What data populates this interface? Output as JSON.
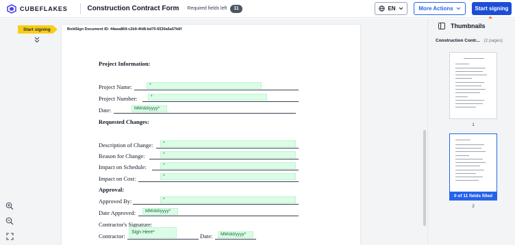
{
  "header": {
    "brand": "CUBEFLAKES",
    "doc_title": "Construction Contract Form",
    "required_label": "Required fields left",
    "required_count": "11",
    "language": "EN",
    "more_actions": "More Actions",
    "start_signing": "Start signing"
  },
  "sidebar": {
    "start_tag": "Start signing"
  },
  "document": {
    "doc_id": "BoldSign Document ID: 44aea869-c2b9-4fd8-bd70-6530a6a57b6f",
    "section_project": "Project Information:",
    "project_name": "Project Name:",
    "project_number": "Project Number:",
    "date": "Date:",
    "section_changes": "Requested Changes:",
    "desc_change": "Description of Change:",
    "reason_change": "Reason for Change:",
    "impact_schedule": "Impact on Schedule:",
    "impact_cost": "Impact on Cost:",
    "section_approval": "Approval:",
    "approved_by": "Approved By:",
    "date_approved": "Date Approved:",
    "contractor_signature": "Contractor's Signature:",
    "contractor": "Contractor:",
    "date2": "Date:",
    "required_mark": "*",
    "date_placeholder": "MM/dd/yyyy",
    "sign_placeholder": "Sign Here"
  },
  "thumbnails": {
    "title": "Thumbnails",
    "doc_name": "Construction Contr...",
    "pages": "(2 pages)",
    "page1": "1",
    "page2": "2",
    "fields_filled": "0 of 11 fields filled"
  },
  "colors": {
    "accent": "#2563eb",
    "start_tag": "#facc15",
    "field_bg": "#dcfce7",
    "arrow": "#f97316"
  }
}
